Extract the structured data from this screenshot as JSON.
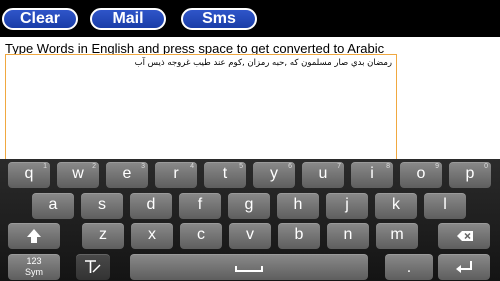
{
  "toolbar": {
    "clear_label": "Clear",
    "mail_label": "Mail",
    "sms_label": "Sms"
  },
  "instruction": "Type Words in English and press space to get converted to Arabic",
  "editor": {
    "text": "رمضان بدي صار مسلمون كه ,حبه رمزان ,كوم عند طيب غروجه ذيس آب"
  },
  "keyboard": {
    "row1": [
      {
        "label": "q",
        "sub": "1"
      },
      {
        "label": "w",
        "sub": "2"
      },
      {
        "label": "e",
        "sub": "3"
      },
      {
        "label": "r",
        "sub": "4"
      },
      {
        "label": "t",
        "sub": "5"
      },
      {
        "label": "y",
        "sub": "6"
      },
      {
        "label": "u",
        "sub": "7"
      },
      {
        "label": "i",
        "sub": "8"
      },
      {
        "label": "o",
        "sub": "9"
      },
      {
        "label": "p",
        "sub": "0"
      }
    ],
    "row2": [
      "a",
      "s",
      "d",
      "f",
      "g",
      "h",
      "j",
      "k",
      "l"
    ],
    "row3": [
      "z",
      "x",
      "c",
      "v",
      "b",
      "n",
      "m"
    ],
    "sym_label_top": "123",
    "sym_label_bottom": "Sym",
    "period_label": ".",
    "icons": {
      "shift": "shift-icon",
      "backspace": "backspace-icon",
      "handwriting": "handwriting-icon",
      "space": "space-icon",
      "enter": "enter-icon"
    }
  },
  "colors": {
    "button_blue": "#2346b8",
    "editor_border": "#f0a840",
    "key_gray": "#777777"
  }
}
